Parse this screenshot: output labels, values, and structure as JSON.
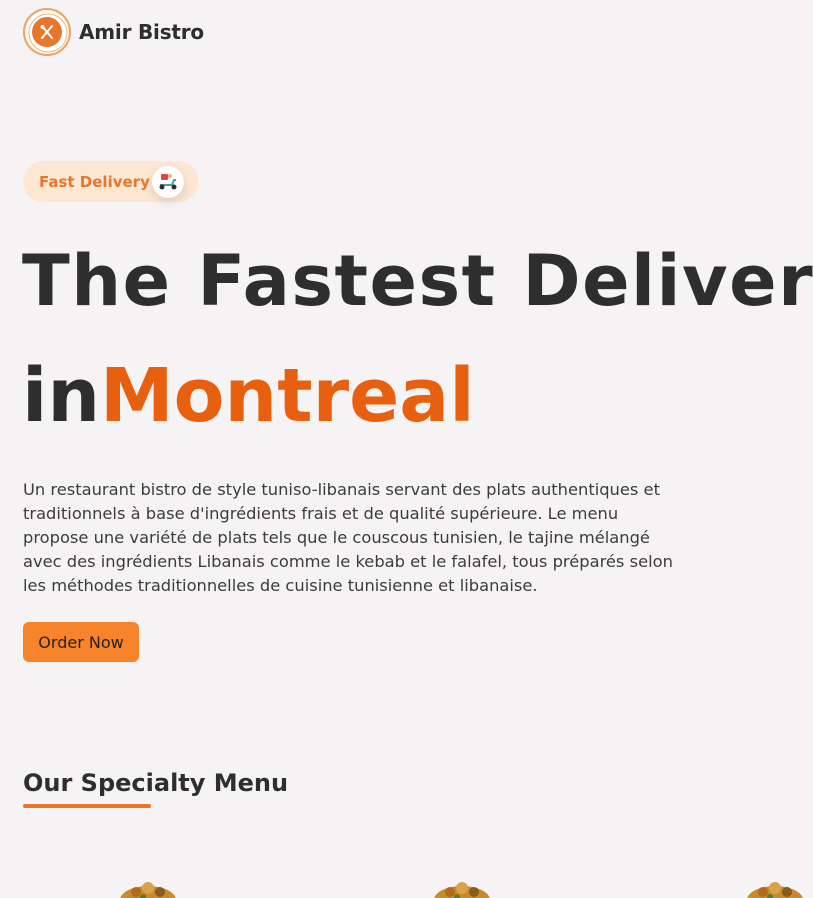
{
  "header": {
    "brand": "Amir Bistro",
    "logo_icon": "fork-knife-icon"
  },
  "hero": {
    "badge_label": "Fast Delivery",
    "badge_icon": "scooter-icon",
    "headline_line1": "The Fastest Delivery",
    "headline_prefix": "in",
    "headline_accent": "Montreal",
    "description": "Un restaurant bistro de style tuniso-libanais servant des plats authentiques et traditionnels à base d'ingrédients frais et de qualité supérieure. Le menu propose une variété de plats tels que le couscous tunisien, le tajine mélangé avec des ingrédients Libanais comme le kebab et le falafel, tous préparés selon les méthodes traditionnelles de cuisine tunisienne et libanaise.",
    "cta_label": "Order Now"
  },
  "specialty": {
    "title": "Our Specialty Menu"
  },
  "colors": {
    "accent": "#e8600f",
    "button": "#f7832a",
    "badge_bg": "#fce7d2",
    "background": "#f5f3f3"
  }
}
